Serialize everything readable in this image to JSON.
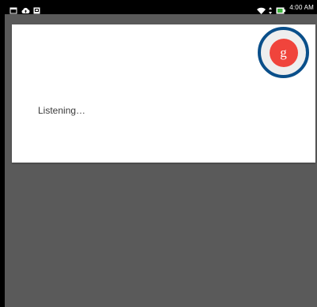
{
  "status_bar": {
    "time": "4:00 AM",
    "left_icons": [
      "notification-window-icon",
      "cloud-upload-icon",
      "screenshot-icon"
    ],
    "right_icons": [
      "wifi-icon",
      "data-transfer-icon",
      "battery-icon"
    ]
  },
  "voice_search": {
    "status_text": "Listening…",
    "mic_button_glyph": "g",
    "mic_button_icon": "google-g-icon"
  },
  "colors": {
    "background": "#5a5a5a",
    "dialog": "#ffffff",
    "mic_button": "#f0443c",
    "highlight_ring": "#0a4f8a",
    "status_bar": "#000000"
  }
}
